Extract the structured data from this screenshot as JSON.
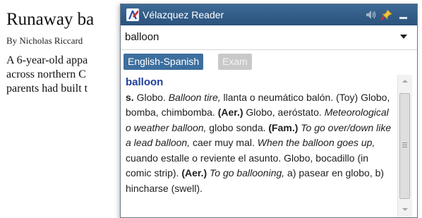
{
  "article": {
    "headline": "Runaway ba",
    "byline": "By Nicholas Riccard",
    "lines": [
      "A 6-year-old appa",
      "across northern C",
      "parents had built t"
    ]
  },
  "popup": {
    "title": "Vélazquez Reader",
    "search_value": "balloon",
    "tabs": [
      "English-Spanish",
      "Exam"
    ],
    "entry": {
      "headword": "balloon",
      "definition": [
        {
          "t": "b",
          "v": "s."
        },
        {
          "t": "n",
          "v": " Globo. "
        },
        {
          "t": "i",
          "v": "Balloon tire,"
        },
        {
          "t": "n",
          "v": " llanta o neumático balón. (Toy) Globo, bomba, chimbomba. "
        },
        {
          "t": "b",
          "v": "(Aer.)"
        },
        {
          "t": "n",
          "v": " Globo, aeróstato. "
        },
        {
          "t": "i",
          "v": "Meteorological o weather balloon,"
        },
        {
          "t": "n",
          "v": " globo sonda. "
        },
        {
          "t": "b",
          "v": "(Fam.)"
        },
        {
          "t": "n",
          "v": " "
        },
        {
          "t": "i",
          "v": "To go over/down like a lead balloon,"
        },
        {
          "t": "n",
          "v": " caer muy mal. "
        },
        {
          "t": "i",
          "v": "When the balloon goes up,"
        },
        {
          "t": "n",
          "v": " cuando estalle o reviente el asunto. Globo, bocadillo (in comic strip). "
        },
        {
          "t": "b",
          "v": "(Aer.)"
        },
        {
          "t": "n",
          "v": " "
        },
        {
          "t": "i",
          "v": "To go ballooning,"
        },
        {
          "t": "n",
          "v": " a) pasear en globo, b) hincharse (swell)."
        }
      ]
    }
  },
  "colors": {
    "titlebar": "#2f5a86",
    "tab_active": "#3d6f9e",
    "tab_inactive": "#c9c9c9",
    "headword": "#1f3f9e"
  },
  "icons": [
    "app-logo-icon",
    "speaker-icon",
    "pin-icon",
    "minimize-icon",
    "chevron-down-icon",
    "scroll-up-icon",
    "scroll-down-icon"
  ]
}
